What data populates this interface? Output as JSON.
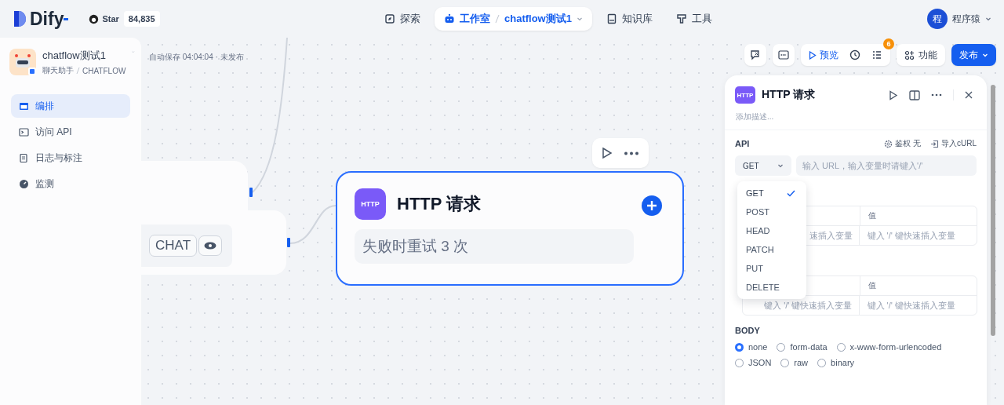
{
  "brand": {
    "logo": "Dify",
    "star_label": "Star",
    "star_count": "84,835"
  },
  "nav": [
    {
      "label": "探索",
      "selected": false
    },
    {
      "label": "工作室",
      "current_app": "chatflow测试1",
      "selected": true
    },
    {
      "label": "知识库",
      "selected": false
    },
    {
      "label": "工具",
      "selected": false
    }
  ],
  "user": {
    "initial": "程",
    "name": "程序猿"
  },
  "app": {
    "name": "chatflow测试1",
    "type_label": "聊天助手",
    "mode": "CHATFLOW"
  },
  "sidebar": {
    "items": [
      {
        "label": "编排",
        "selected": true
      },
      {
        "label": "访问 API",
        "selected": false
      },
      {
        "label": "日志与标注",
        "selected": false
      },
      {
        "label": "监测",
        "selected": false
      }
    ]
  },
  "status": "自动保存 04:04:04 · 未发布",
  "toolbar": {
    "preview": "预览",
    "checklist_badge": "6",
    "features": "功能",
    "publish": "发布"
  },
  "canvas": {
    "chat_tag": "CHAT",
    "node": {
      "badge": "HTTP",
      "title": "HTTP 请求",
      "retry": "失败时重试 3 次"
    }
  },
  "panel": {
    "badge": "HTTP",
    "title": "HTTP 请求",
    "description_placeholder": "添加描述...",
    "api_label": "API",
    "auth": "鉴权 无",
    "import": "导入cURL",
    "method": "GET",
    "url_placeholder": "输入 URL，输入变量时请键入'/'",
    "methods": [
      {
        "label": "GET",
        "selected": true
      },
      {
        "label": "POST",
        "selected": false
      },
      {
        "label": "HEAD",
        "selected": false
      },
      {
        "label": "PATCH",
        "selected": false
      },
      {
        "label": "PUT",
        "selected": false
      },
      {
        "label": "DELETE",
        "selected": false
      }
    ],
    "tables": [
      {
        "value_header": "值",
        "key_cell": "速插入变量",
        "value_cell": "键入 '/' 键快速插入变量"
      },
      {
        "value_header": "值",
        "key_cell": "键入 '/' 键快速插入变量",
        "value_cell": "键入 '/' 键快速插入变量"
      }
    ],
    "body_label": "BODY",
    "body_options": [
      {
        "label": "none",
        "selected": true
      },
      {
        "label": "form-data",
        "selected": false
      },
      {
        "label": "x-www-form-urlencoded",
        "selected": false
      },
      {
        "label": "JSON",
        "selected": false
      },
      {
        "label": "raw",
        "selected": false
      },
      {
        "label": "binary",
        "selected": false
      }
    ]
  }
}
